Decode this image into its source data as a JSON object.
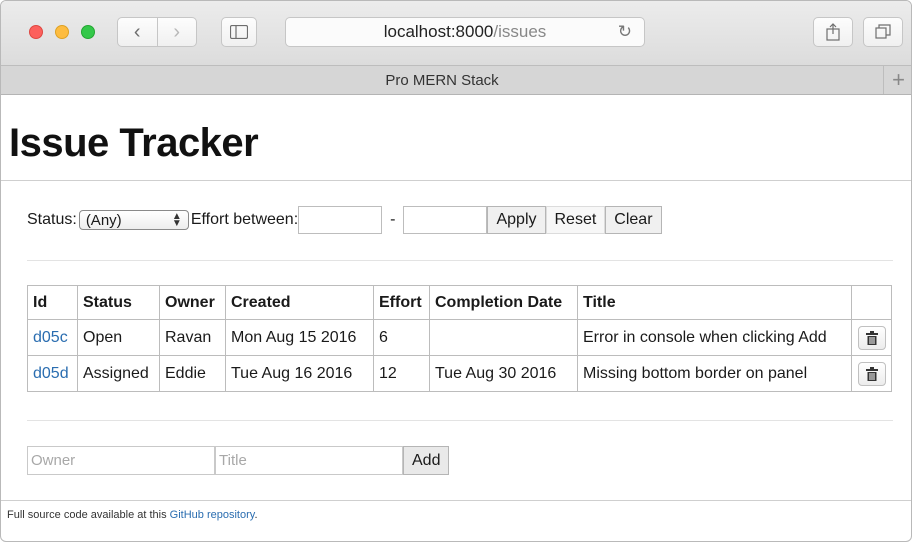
{
  "browser": {
    "url_host": "localhost:8000",
    "url_path": "/issues",
    "tab_title": "Pro MERN Stack",
    "reload_icon": "↻",
    "new_tab": "+"
  },
  "page": {
    "title": "Issue Tracker"
  },
  "filter": {
    "status_label": "Status:",
    "status_value": "(Any)",
    "effort_label": "Effort between:",
    "dash": "-",
    "apply_label": "Apply",
    "reset_label": "Reset",
    "clear_label": "Clear"
  },
  "table": {
    "headers": [
      "Id",
      "Status",
      "Owner",
      "Created",
      "Effort",
      "Completion Date",
      "Title",
      ""
    ],
    "rows": [
      {
        "id": "d05c",
        "status": "Open",
        "owner": "Ravan",
        "created": "Mon Aug 15 2016",
        "effort": "6",
        "completion": "",
        "title": "Error in console when clicking Add"
      },
      {
        "id": "d05d",
        "status": "Assigned",
        "owner": "Eddie",
        "created": "Tue Aug 16 2016",
        "effort": "12",
        "completion": "Tue Aug 30 2016",
        "title": "Missing bottom border on panel"
      }
    ]
  },
  "add_form": {
    "owner_placeholder": "Owner",
    "title_placeholder": "Title",
    "add_label": "Add"
  },
  "footer": {
    "text": "Full source code available at this ",
    "link": "GitHub repository",
    "period": "."
  },
  "colors": {
    "link": "#2a6db0"
  }
}
